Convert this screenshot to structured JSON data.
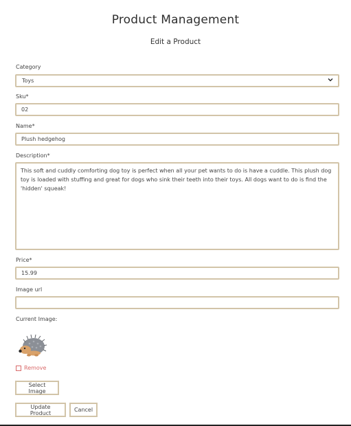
{
  "header": {
    "title": "Product Management",
    "subtitle": "Edit a Product"
  },
  "form": {
    "category": {
      "label": "Category",
      "value": "Toys"
    },
    "sku": {
      "label": "Sku",
      "required_mark": "*",
      "value": "02"
    },
    "name": {
      "label": "Name",
      "required_mark": "*",
      "value": "Plush hedgehog"
    },
    "description": {
      "label": "Description",
      "required_mark": "*",
      "value": "This soft and cuddly comforting dog toy is perfect when all your pet wants to do is have a cuddle. This plush dog toy is loaded with stuffing and great for dogs who sink their teeth into their toys. All dogs want to do is find the 'hidden' squeak!"
    },
    "price": {
      "label": "Price",
      "required_mark": "*",
      "value": "15.99"
    },
    "image_url": {
      "label": "Image url",
      "value": ""
    },
    "current_image": {
      "label": "Current Image:",
      "icon": "hedgehog-toy-image"
    },
    "remove": {
      "label": "Remove",
      "checked": false
    }
  },
  "buttons": {
    "select_image": "Select Image",
    "update_product": "Update Product",
    "cancel": "Cancel"
  },
  "colors": {
    "field_border": "#d2c4a8",
    "remove_text": "#d96a6a"
  }
}
